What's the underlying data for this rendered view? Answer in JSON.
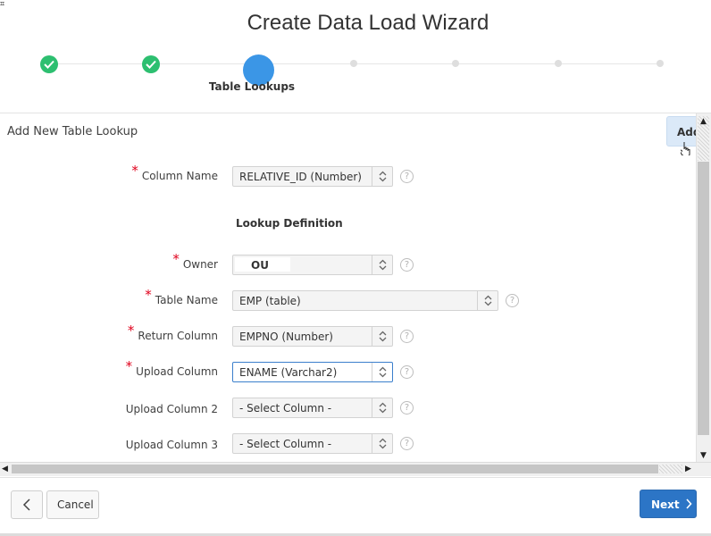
{
  "wizard": {
    "title": "Create Data Load Wizard",
    "current_step_label": "Table Lookups"
  },
  "region": {
    "title": "Add New Table Lookup",
    "add_button_label": "Add",
    "lookup_heading": "Lookup Definition"
  },
  "form": {
    "column_name": {
      "label": "Column Name",
      "value": "RELATIVE_ID (Number)"
    },
    "owner": {
      "label": "Owner",
      "value": "OU"
    },
    "table_name": {
      "label": "Table Name",
      "value": "EMP (table)"
    },
    "return_column": {
      "label": "Return Column",
      "value": "EMPNO (Number)"
    },
    "upload_column": {
      "label": "Upload Column",
      "value": "ENAME (Varchar2)"
    },
    "upload_column_2": {
      "label": "Upload Column 2",
      "value": "- Select Column -"
    },
    "upload_column_3": {
      "label": "Upload Column 3",
      "value": "- Select Column -"
    },
    "required_marker": "*",
    "help_glyph": "?"
  },
  "footer": {
    "cancel_label": "Cancel",
    "next_label": "Next"
  },
  "colors": {
    "step_done": "#2dbf70",
    "step_current": "#3b96e6",
    "primary_button": "#2c75c6",
    "required": "#e0001c"
  }
}
